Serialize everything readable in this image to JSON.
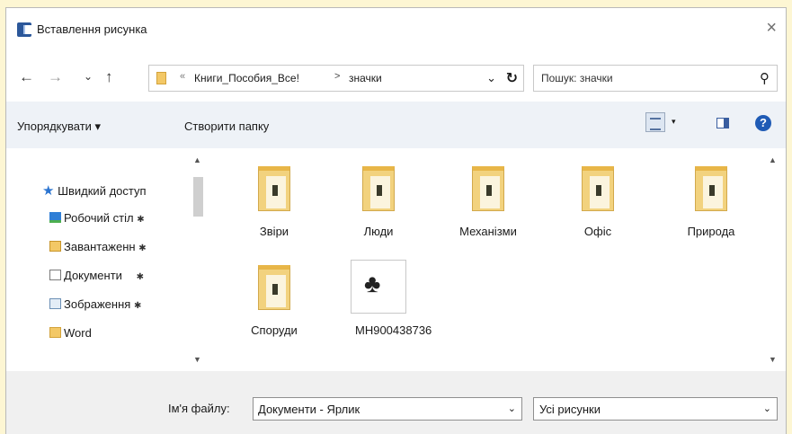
{
  "window": {
    "title": "Вставлення рисунка",
    "close_symbol": "×"
  },
  "nav": {
    "back": "←",
    "forward": "→",
    "recent": "⌄",
    "up": "↑",
    "refresh": "↻"
  },
  "address": {
    "overflow": "«",
    "crumbs": [
      "Книги_Пособия_Все!",
      "значки"
    ],
    "separator": ">"
  },
  "search": {
    "placeholder": "Пошук: значки",
    "icon": "search-icon"
  },
  "toolbar": {
    "organize": "Упорядкувати ▾",
    "new_folder": "Створити папку",
    "view_dropdown": "▾",
    "help": "?"
  },
  "sidebar": {
    "items": [
      {
        "label": "Швидкий доступ",
        "icon": "star-icon",
        "pinned": false
      },
      {
        "label": "Робочий стіл",
        "icon": "desktop-icon",
        "pinned": true
      },
      {
        "label": "Завантаженн",
        "icon": "downloads-icon",
        "pinned": true
      },
      {
        "label": "Документи",
        "icon": "documents-icon",
        "pinned": true
      },
      {
        "label": "Зображення",
        "icon": "pictures-icon",
        "pinned": true
      },
      {
        "label": "Word",
        "icon": "folder-icon",
        "pinned": false
      }
    ],
    "pin_symbol": "✱"
  },
  "files": [
    {
      "label": "Звіри",
      "type": "folder"
    },
    {
      "label": "Люди",
      "type": "folder"
    },
    {
      "label": "Механізми",
      "type": "folder"
    },
    {
      "label": "Офіс",
      "type": "folder"
    },
    {
      "label": "Природа",
      "type": "folder"
    },
    {
      "label": "Споруди",
      "type": "folder"
    },
    {
      "label": "MH900438736",
      "type": "image"
    }
  ],
  "footer": {
    "filename_label": "Ім'я файлу:",
    "filename_value": "Документи - Ярлик",
    "filetype_value": "Усі рисунки"
  }
}
